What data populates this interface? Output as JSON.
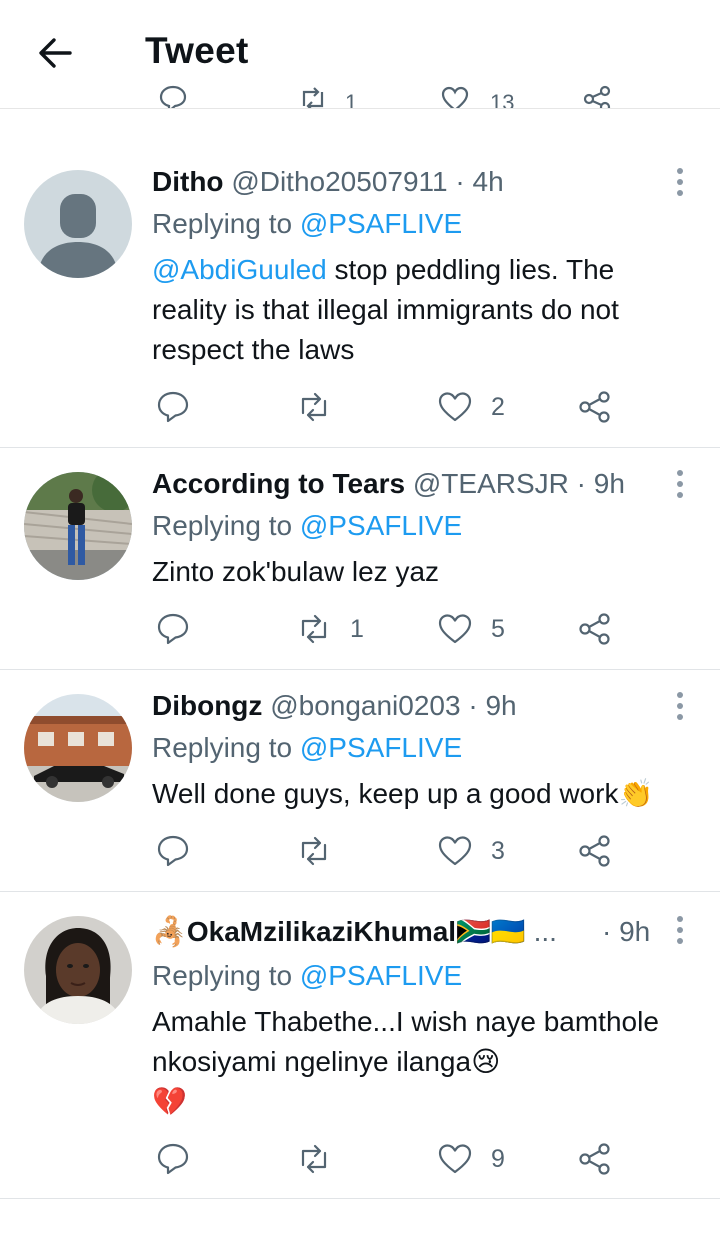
{
  "header": {
    "title": "Tweet",
    "back_icon": "arrow-left-icon"
  },
  "prev_tweet_peek": {
    "retweets": "1",
    "likes": "13"
  },
  "colors": {
    "link": "#1d9bf0",
    "secondary_text": "#536471",
    "primary_text": "#0f1419",
    "divider": "#e1e4e7"
  },
  "tweets": [
    {
      "display_name": "Ditho",
      "handle": "@Ditho20507911",
      "separator": "·",
      "time": "4h",
      "replying_prefix": "Replying to",
      "replying_to": "@PSAFLIVE",
      "body_mention": "@AbdiGuuled",
      "body": "stop peddling lies. The reality is that illegal immigrants do not respect the laws",
      "replies": "",
      "retweets": "",
      "likes": "2"
    },
    {
      "display_name": "According to Tears",
      "handle": "@TEARSJR",
      "separator": "·",
      "time": "9h",
      "replying_prefix": "Replying to",
      "replying_to": "@PSAFLIVE",
      "body": "Zinto zok'bulaw lez yaz",
      "replies": "",
      "retweets": "1",
      "likes": "5"
    },
    {
      "display_name": "Dibongz",
      "handle": "@bongani0203",
      "separator": "·",
      "time": "9h",
      "replying_prefix": "Replying to",
      "replying_to": "@PSAFLIVE",
      "body": "Well done guys, keep up a good work",
      "body_emoji": "👏",
      "replies": "",
      "retweets": "",
      "likes": "3"
    },
    {
      "display_name_emoji": "🦂",
      "display_name": "OkaMzilikaziKhumal",
      "name_flags": "🇿🇦🇺🇦",
      "name_ellipsis": "...",
      "separator": "·",
      "time": "9h",
      "replying_prefix": "Replying to",
      "replying_to": "@PSAFLIVE",
      "body": "Amahle Thabethe...I wish naye bamthole nkosiyami ngelinye ilanga",
      "body_emoji": "😢",
      "body_emoji_2": "💔",
      "replies": "",
      "retweets": "",
      "likes": "9"
    }
  ]
}
